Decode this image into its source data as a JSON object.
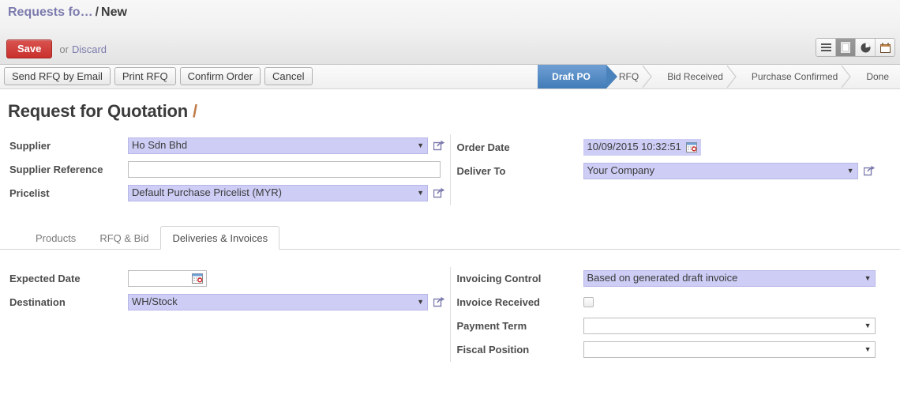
{
  "header": {
    "breadcrumb_parent": "Requests fo…",
    "breadcrumb_separator": "/",
    "breadcrumb_current": "New",
    "save_label": "Save",
    "or_label": "or",
    "discard_label": "Discard",
    "view_switcher": [
      {
        "name": "list-view-icon",
        "label": "List",
        "active": false
      },
      {
        "name": "form-view-icon",
        "label": "Form",
        "active": true
      },
      {
        "name": "graph-view-icon",
        "label": "Graph",
        "active": false
      },
      {
        "name": "calendar-view-icon",
        "label": "Calendar",
        "active": false
      }
    ]
  },
  "actions": {
    "buttons": [
      "Send RFQ by Email",
      "Print RFQ",
      "Confirm Order",
      "Cancel"
    ]
  },
  "statusbar": {
    "steps": [
      {
        "label": "Draft PO",
        "active": true
      },
      {
        "label": "RFQ",
        "active": false
      },
      {
        "label": "Bid Received",
        "active": false
      },
      {
        "label": "Purchase Confirmed",
        "active": false
      },
      {
        "label": "Done",
        "active": false
      }
    ],
    "active_color": "#417cb8"
  },
  "form": {
    "title": "Request for Quotation",
    "title_suffix": "/",
    "left": {
      "supplier_label": "Supplier",
      "supplier_value": "Ho Sdn Bhd",
      "supplier_reference_label": "Supplier Reference",
      "supplier_reference_value": "",
      "pricelist_label": "Pricelist",
      "pricelist_value": "Default Purchase Pricelist (MYR)"
    },
    "right": {
      "order_date_label": "Order Date",
      "order_date_value": "10/09/2015 10:32:51",
      "deliver_to_label": "Deliver To",
      "deliver_to_value": "Your Company"
    }
  },
  "notebook": {
    "tabs": [
      {
        "label": "Products",
        "active": false
      },
      {
        "label": "RFQ & Bid",
        "active": false
      },
      {
        "label": "Deliveries & Invoices",
        "active": true
      }
    ],
    "left": {
      "expected_date_label": "Expected Date",
      "expected_date_value": "",
      "destination_label": "Destination",
      "destination_value": "WH/Stock"
    },
    "right": {
      "invoicing_control_label": "Invoicing Control",
      "invoicing_control_value": "Based on generated draft invoice",
      "invoice_received_label": "Invoice Received",
      "invoice_received_checked": false,
      "payment_term_label": "Payment Term",
      "payment_term_value": "",
      "fiscal_position_label": "Fiscal Position",
      "fiscal_position_value": ""
    }
  },
  "colors": {
    "accent_purple": "#7c7bad",
    "field_fill": "#cdcdf5",
    "save_red": "#c9302c",
    "status_blue": "#417cb8"
  }
}
